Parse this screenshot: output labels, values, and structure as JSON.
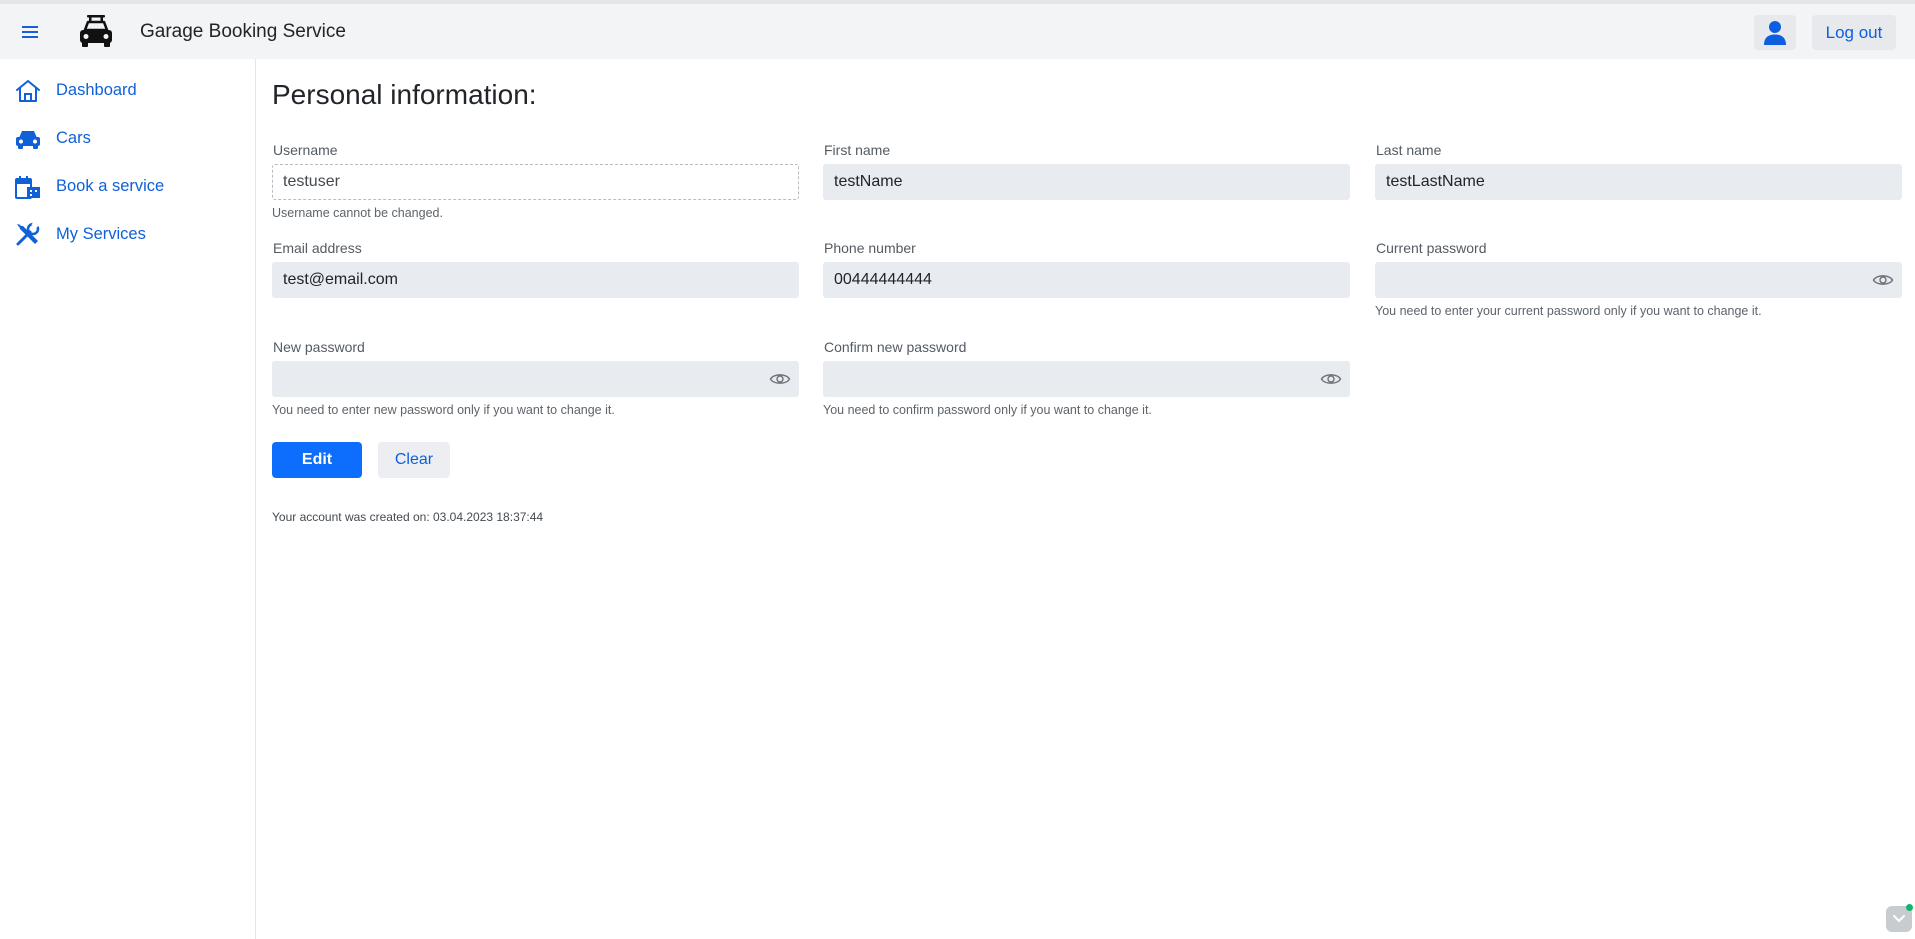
{
  "app": {
    "title": "Garage Booking Service"
  },
  "header": {
    "logout_label": "Log out"
  },
  "sidebar": {
    "items": [
      {
        "label": "Dashboard",
        "icon": "home-icon"
      },
      {
        "label": "Cars",
        "icon": "car-icon"
      },
      {
        "label": "Book a service",
        "icon": "calendar-icon"
      },
      {
        "label": "My Services",
        "icon": "tools-icon"
      }
    ]
  },
  "page": {
    "title": "Personal information:"
  },
  "form": {
    "username": {
      "label": "Username",
      "value": "testuser",
      "help": "Username cannot be changed."
    },
    "first_name": {
      "label": "First name",
      "value": "testName"
    },
    "last_name": {
      "label": "Last name",
      "value": "testLastName"
    },
    "email": {
      "label": "Email address",
      "value": "test@email.com"
    },
    "phone": {
      "label": "Phone number",
      "value": "00444444444"
    },
    "current_password": {
      "label": "Current password",
      "value": "",
      "help": "You need to enter your current password only if you want to change it."
    },
    "new_password": {
      "label": "New password",
      "value": "",
      "help": "You need to enter new password only if you want to change it."
    },
    "confirm_password": {
      "label": "Confirm new password",
      "value": "",
      "help": "You need to confirm password only if you want to change it."
    },
    "edit_label": "Edit",
    "clear_label": "Clear",
    "created_text": "Your account was created on: 03.04.2023 18:37:44"
  },
  "colors": {
    "accent": "#0d6efd",
    "link": "#1060d8",
    "header_bg": "#f3f4f6",
    "input_bg": "#e8ebef"
  }
}
